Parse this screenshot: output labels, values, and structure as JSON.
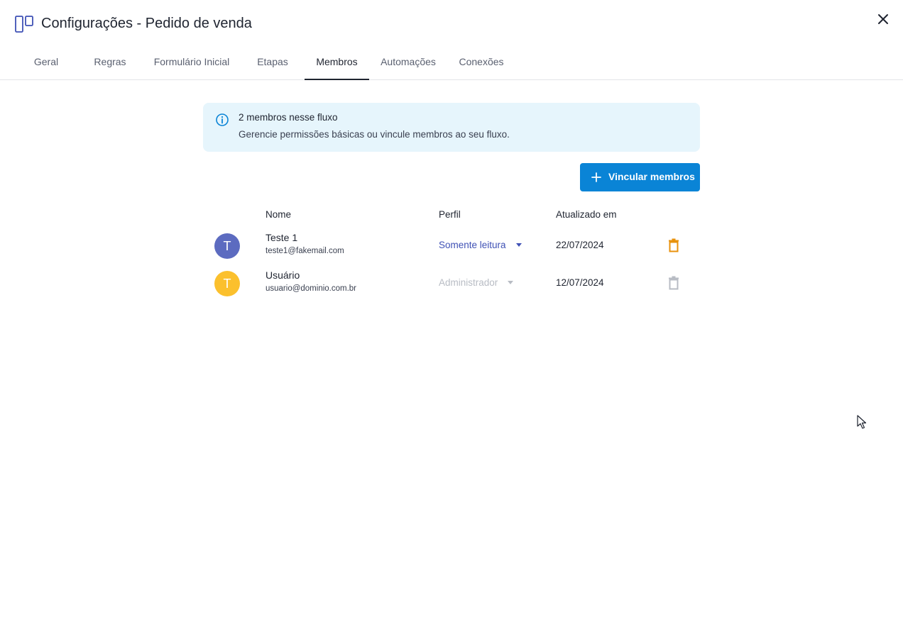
{
  "header": {
    "title": "Configurações - Pedido de venda",
    "app_icon": "kanban-board-icon",
    "close_icon": "close-icon"
  },
  "tabs": [
    {
      "label": "Geral",
      "active": false
    },
    {
      "label": "Regras",
      "active": false
    },
    {
      "label": "Formulário Inicial",
      "active": false
    },
    {
      "label": "Etapas",
      "active": false
    },
    {
      "label": "Membros",
      "active": true
    },
    {
      "label": "Automações",
      "active": false
    },
    {
      "label": "Conexões",
      "active": false
    }
  ],
  "info": {
    "icon": "info-icon",
    "title": "2 membros nesse fluxo",
    "text": "Gerencie permissões básicas ou vincule membros ao seu fluxo."
  },
  "actions": {
    "add_members_label": "Vincular membros",
    "add_icon": "plus-icon"
  },
  "table": {
    "columns": {
      "name": "Nome",
      "profile": "Perfil",
      "updated": "Atualizado em"
    },
    "rows": [
      {
        "avatar_letter": "T",
        "avatar_color": "#5c6bc0",
        "name": "Teste 1",
        "email": "teste1@fakemail.com",
        "profile": "Somente leitura",
        "profile_enabled": true,
        "updated": "22/07/2024",
        "delete_enabled": true
      },
      {
        "avatar_letter": "T",
        "avatar_color": "#fbc02d",
        "name": "Usuário",
        "email": "usuario@dominio.com.br",
        "profile": "Administrador",
        "profile_enabled": false,
        "updated": "12/07/2024",
        "delete_enabled": false
      }
    ]
  },
  "colors": {
    "accent": "#0a84d6",
    "info_bg": "#e6f5fc",
    "profile_active": "#3f51b5",
    "profile_disabled": "#b8bcc4",
    "delete_active": "#e8920c",
    "delete_disabled": "#b8bcc4"
  }
}
